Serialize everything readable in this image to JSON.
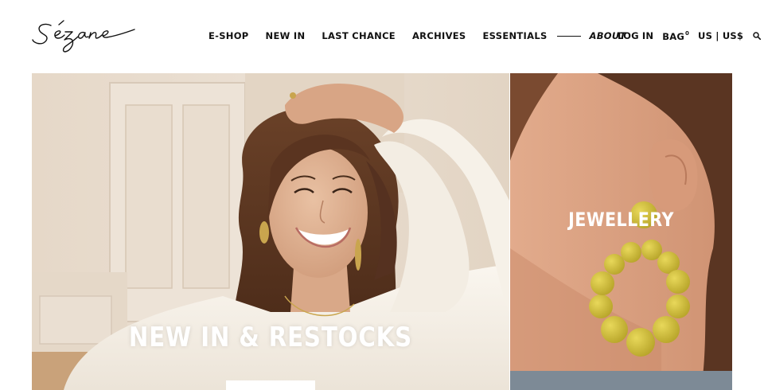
{
  "brand": {
    "name": "Sézane"
  },
  "nav": {
    "items": [
      {
        "label": "E-SHOP"
      },
      {
        "label": "NEW IN"
      },
      {
        "label": "LAST CHANCE"
      },
      {
        "label": "ARCHIVES"
      },
      {
        "label": "ESSENTIALS"
      }
    ],
    "about_label": "ABOUT"
  },
  "utility": {
    "login_label": "LOG IN",
    "bag_label": "BAG",
    "bag_count": "0",
    "locale_label": "US | US$"
  },
  "hero": {
    "main_title": "NEW IN & RESTOCKS",
    "side_title": "JEWELLERY"
  },
  "colors": {
    "text": "#111111",
    "background": "#ffffff",
    "earring_yellow": "#d6c332"
  }
}
